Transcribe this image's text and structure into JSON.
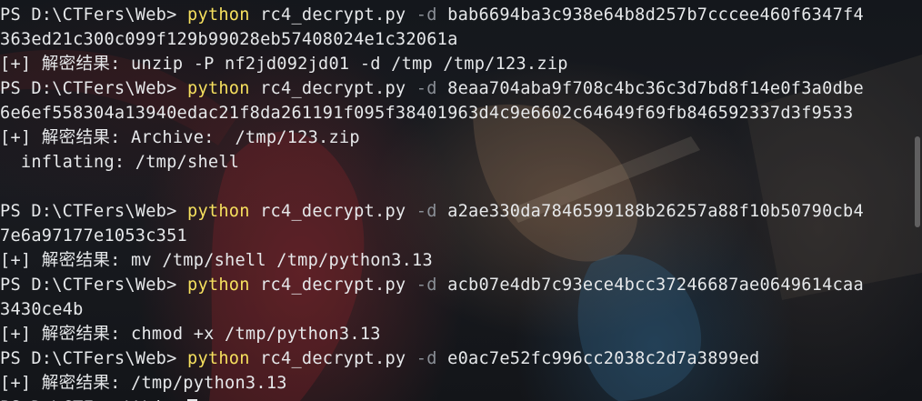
{
  "terminal": {
    "lines": [
      {
        "type": "cmd",
        "prompt": "PS D:\\CTFers\\Web> ",
        "exe": "python",
        "script": " rc4_decrypt.py ",
        "flag": "-d",
        "hex": " bab6694ba3c938e64b8d257b7cccee460f6347f4"
      },
      {
        "type": "text",
        "text": "363ed21c300c099f129b99028eb57408024e1c32061a"
      },
      {
        "type": "result",
        "tag": "[+] 解密结果: ",
        "text": "unzip -P nf2jd092jd01 -d /tmp /tmp/123.zip"
      },
      {
        "type": "cmd",
        "prompt": "PS D:\\CTFers\\Web> ",
        "exe": "python",
        "script": " rc4_decrypt.py ",
        "flag": "-d",
        "hex": " 8eaa704aba9f708c4bc36c3d7bd8f14e0f3a0dbe"
      },
      {
        "type": "text",
        "text": "6e6ef558304a13940edac21f8da261191f095f38401963d4c9e6602c64649f69fb846592337d3f9533"
      },
      {
        "type": "result",
        "tag": "[+] 解密结果: ",
        "text": "Archive:  /tmp/123.zip"
      },
      {
        "type": "text",
        "text": "  inflating: /tmp/shell"
      },
      {
        "type": "text",
        "text": ""
      },
      {
        "type": "cmd",
        "prompt": "PS D:\\CTFers\\Web> ",
        "exe": "python",
        "script": " rc4_decrypt.py ",
        "flag": "-d",
        "hex": " a2ae330da7846599188b26257a88f10b50790cb4"
      },
      {
        "type": "text",
        "text": "7e6a97177e1053c351"
      },
      {
        "type": "result",
        "tag": "[+] 解密结果: ",
        "text": "mv /tmp/shell /tmp/python3.13"
      },
      {
        "type": "cmd",
        "prompt": "PS D:\\CTFers\\Web> ",
        "exe": "python",
        "script": " rc4_decrypt.py ",
        "flag": "-d",
        "hex": " acb07e4db7c93ece4bcc37246687ae0649614caa"
      },
      {
        "type": "text",
        "text": "3430ce4b"
      },
      {
        "type": "result",
        "tag": "[+] 解密结果: ",
        "text": "chmod +x /tmp/python3.13"
      },
      {
        "type": "cmd",
        "prompt": "PS D:\\CTFers\\Web> ",
        "exe": "python",
        "script": " rc4_decrypt.py ",
        "flag": "-d",
        "hex": " e0ac7e52fc996cc2038c2d7a3899ed"
      },
      {
        "type": "result",
        "tag": "[+] 解密结果: ",
        "text": "/tmp/python3.13"
      },
      {
        "type": "prompt",
        "prompt": "PS D:\\CTFers\\Web> "
      }
    ]
  },
  "colors": {
    "command": "#f6e05e",
    "flag": "#8a8f96",
    "text": "#e6e8ea"
  }
}
